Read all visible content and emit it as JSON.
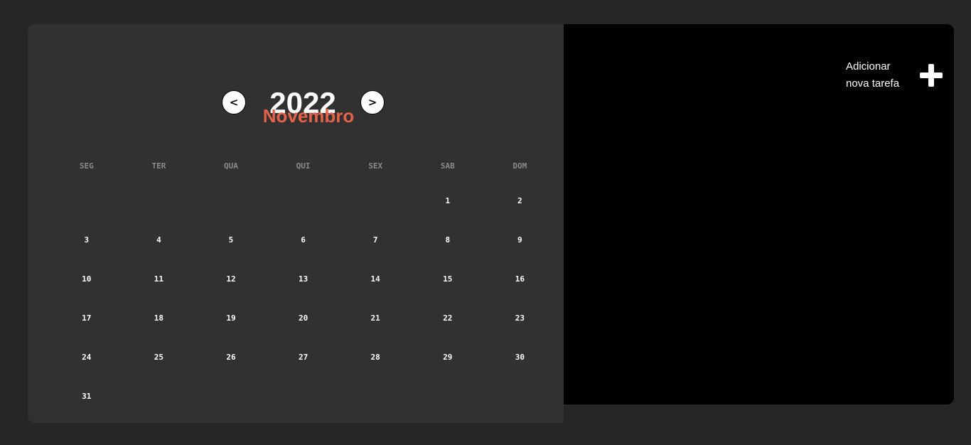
{
  "calendar": {
    "year": "2022",
    "month": "Novembro",
    "prev_label": "<",
    "next_label": ">",
    "weekdays": [
      "SEG",
      "TER",
      "QUA",
      "QUI",
      "SEX",
      "SAB",
      "DOM"
    ],
    "leading_blanks": 5,
    "days": [
      "1",
      "2",
      "3",
      "4",
      "5",
      "6",
      "7",
      "8",
      "9",
      "10",
      "11",
      "12",
      "13",
      "14",
      "15",
      "16",
      "17",
      "18",
      "19",
      "20",
      "21",
      "22",
      "23",
      "24",
      "25",
      "26",
      "27",
      "28",
      "29",
      "30",
      "31"
    ],
    "accent_color": "#e5624a"
  },
  "tasks": {
    "add_label_line1": "Adicionar",
    "add_label_line2": "nova tarefa",
    "add_icon": "plus-icon"
  }
}
